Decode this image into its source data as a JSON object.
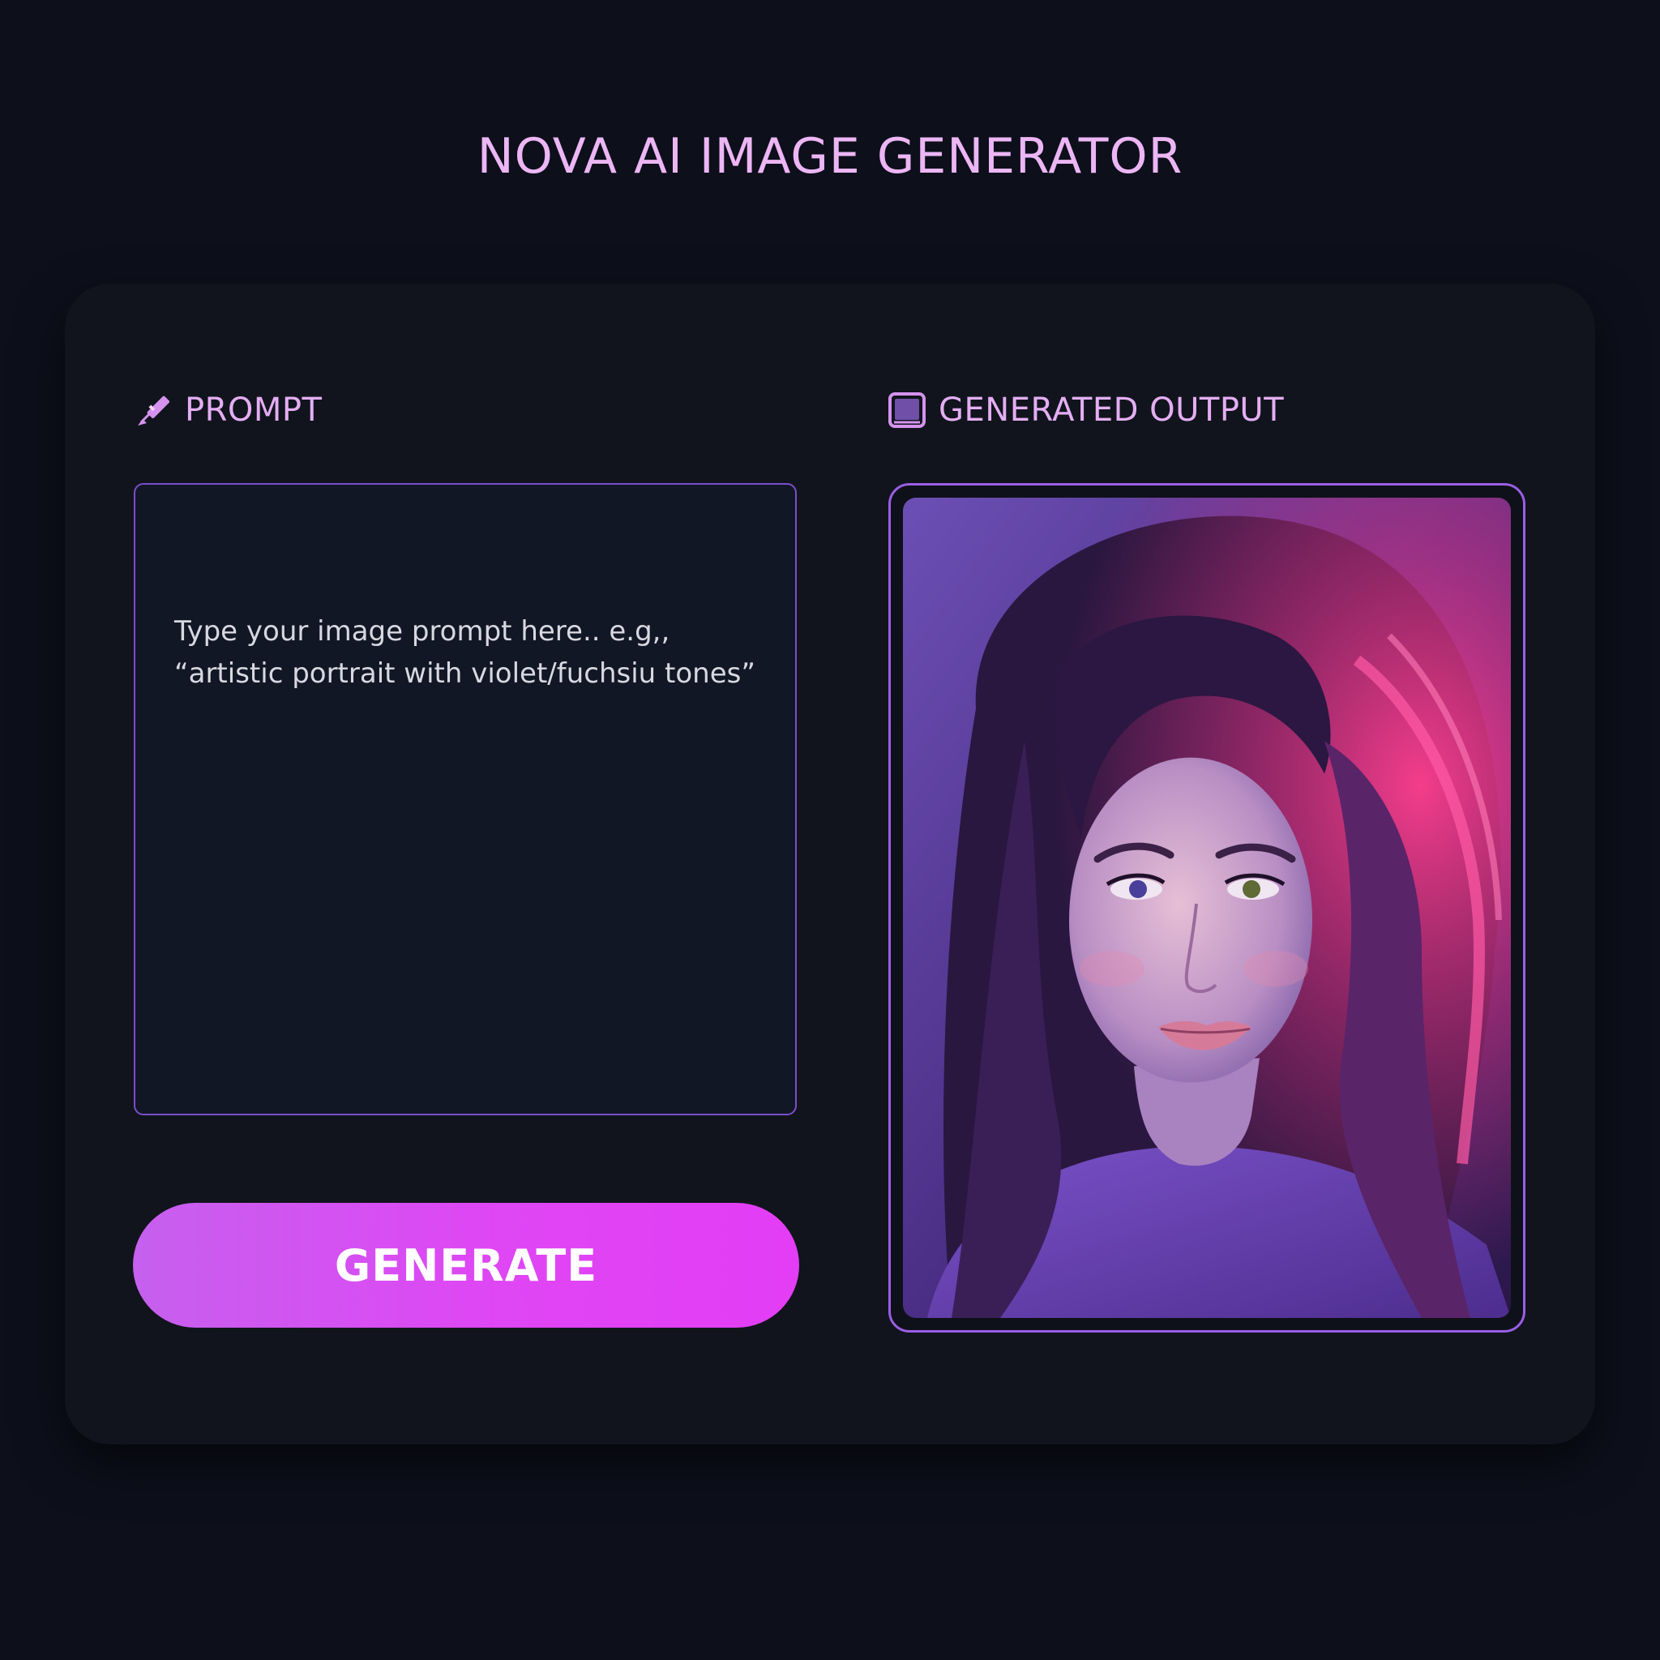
{
  "app": {
    "title": "NOVA AI IMAGE GENERATOR"
  },
  "prompt_panel": {
    "heading": "PROMPT",
    "icon": "paintbrush-icon",
    "placeholder": "Type your image prompt here.. e.g,, “artistic portrait with violet/fuchsiu tones”"
  },
  "generate_button": {
    "label": "GENERATE"
  },
  "output_panel": {
    "heading": "GENERATED OUTPUT",
    "icon": "image-frame-icon",
    "image_content": "portrait-illustration"
  },
  "colors": {
    "background": "#0d0f1b",
    "card": "#11141d",
    "accent_text": "#e4aef3",
    "border_accent": "#8a55d8",
    "button_gradient_start": "#c660ee",
    "button_gradient_end": "#e33df5"
  }
}
